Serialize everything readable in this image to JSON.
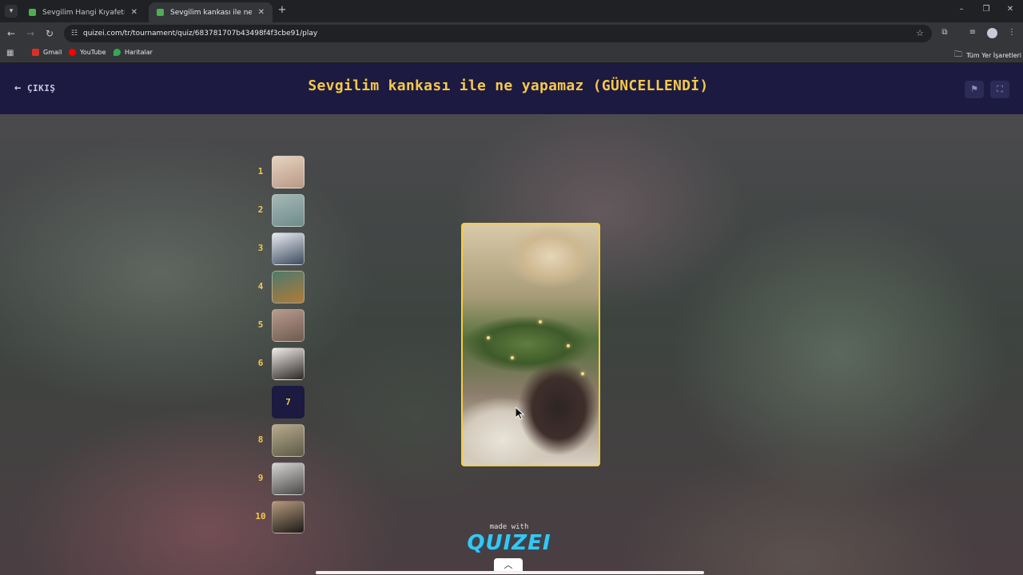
{
  "browser": {
    "tabs": [
      {
        "title": "Sevgilim Hangi Kıyafeti Dışarda",
        "active": false
      },
      {
        "title": "Sevgilim kankası ile ne yapamaz",
        "active": true
      }
    ],
    "url": "quizei.com/tr/tournament/quiz/683781707b43498f4f3cbe91/play",
    "bookmarks": [
      {
        "label": "Gmail",
        "icon": "gmail-icon",
        "color": "#d93025"
      },
      {
        "label": "YouTube",
        "icon": "youtube-icon",
        "color": "#ff0000"
      },
      {
        "label": "Haritalar",
        "icon": "maps-pin-icon",
        "color": "#34a853"
      }
    ],
    "all_bookmarks_label": "Tüm Yer İşaretleri"
  },
  "quiz": {
    "exit_label": "ÇIKIŞ",
    "title": "Sevgilim kankası ile ne yapamaz (GÜNCELLENDİ)",
    "current_round": "7",
    "rounds": [
      {
        "num": "1",
        "colors": [
          "#e6d2c0",
          "#b89a86"
        ]
      },
      {
        "num": "2",
        "colors": [
          "#a5b9b6",
          "#6e8c8a"
        ]
      },
      {
        "num": "3",
        "colors": [
          "#e9ecef",
          "#3d4a60"
        ]
      },
      {
        "num": "4",
        "colors": [
          "#4f7a6a",
          "#b07a3a"
        ]
      },
      {
        "num": "5",
        "colors": [
          "#b89b8c",
          "#6f5a50"
        ]
      },
      {
        "num": "6",
        "colors": [
          "#f0ece8",
          "#2c2626"
        ]
      },
      {
        "num": "7",
        "current": true
      },
      {
        "num": "8",
        "colors": [
          "#b9aa8e",
          "#5b5a45"
        ]
      },
      {
        "num": "9",
        "colors": [
          "#d7d5d2",
          "#494848"
        ]
      },
      {
        "num": "10",
        "colors": [
          "#b59a7d",
          "#1c1a18"
        ]
      }
    ],
    "made_with": "made with",
    "brand": "QUIZEI",
    "accent_color": "#f4c84a",
    "card_border_color": "#f5cf3c"
  }
}
